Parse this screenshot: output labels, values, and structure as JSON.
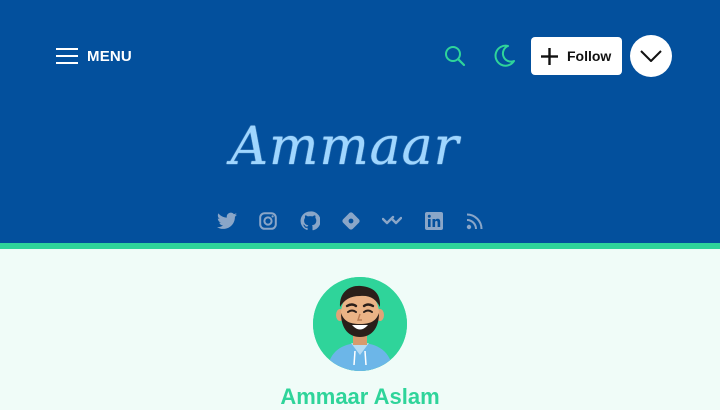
{
  "header": {
    "menu_label": "MENU",
    "follow_label": "Follow",
    "logo_text": "Ammaar"
  },
  "social_icons": [
    "twitter-icon",
    "instagram-icon",
    "github-icon",
    "gitlab-icon",
    "devto-icon",
    "linkedin-icon",
    "rss-icon"
  ],
  "author": {
    "name": "Ammaar Aslam"
  },
  "colors": {
    "header_bg": "#03509d",
    "accent": "#2fd49a",
    "page_bg": "#f0fcf8",
    "icon_muted": "#8aa6c8"
  }
}
